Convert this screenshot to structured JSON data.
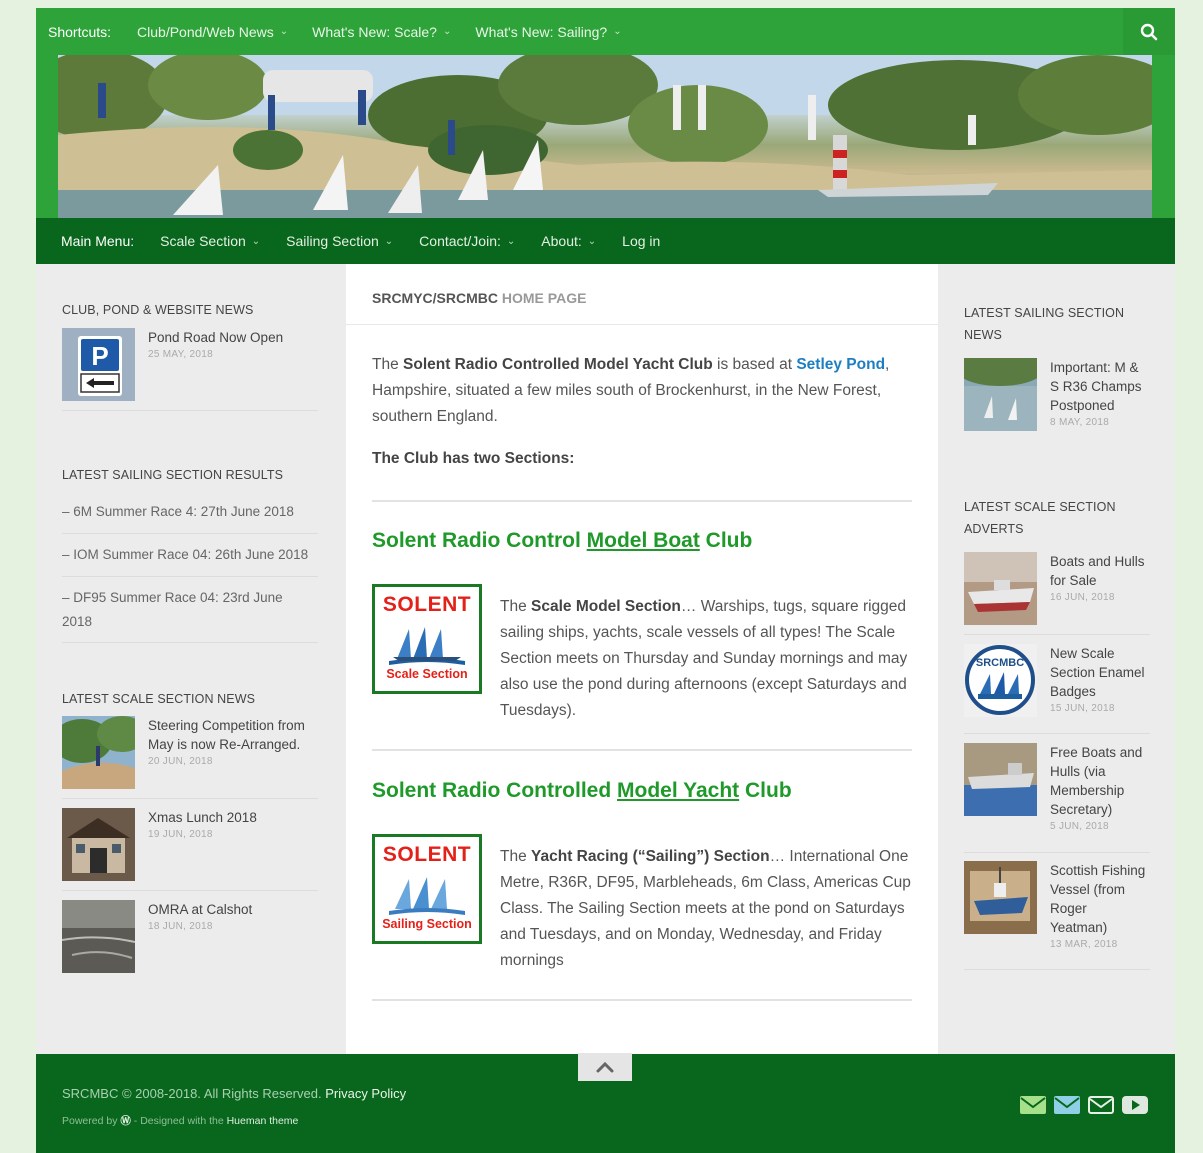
{
  "topbar": {
    "label": "Shortcuts:",
    "items": [
      {
        "label": "Club/Pond/Web News"
      },
      {
        "label": "What's New: Scale?"
      },
      {
        "label": "What's New: Sailing?"
      }
    ],
    "search_icon": "search-icon"
  },
  "main_menu": {
    "label": "Main Menu:",
    "items": [
      {
        "label": "Scale Section",
        "dropdown": true
      },
      {
        "label": "Sailing Section",
        "dropdown": true
      },
      {
        "label": "Contact/Join:",
        "dropdown": true
      },
      {
        "label": "About:",
        "dropdown": true
      },
      {
        "label": "Log in",
        "dropdown": false
      }
    ]
  },
  "left_sidebar": {
    "club_news": {
      "title": "CLUB, POND & WEBSITE NEWS",
      "posts": [
        {
          "title": "Pond Road Now Open",
          "date": "25 MAY, 2018"
        }
      ]
    },
    "sailing_results": {
      "title": "LATEST SAILING SECTION RESULTS",
      "items": [
        {
          "label": "– 6M Summer Race 4: 27th June 2018"
        },
        {
          "label": "– IOM Summer Race 04: 26th June 2018"
        },
        {
          "label_line1": "– DF95 Summer Race 04: 23rd June",
          "label_line2": "2018"
        }
      ]
    },
    "scale_news": {
      "title": "LATEST SCALE SECTION NEWS",
      "posts": [
        {
          "title_line1": "Steering Competition from",
          "title_line2": "May is now Re-Arranged.",
          "date": "20 JUN, 2018"
        },
        {
          "title": "Xmas Lunch 2018",
          "date": "19 JUN, 2018"
        },
        {
          "title": "OMRA at Calshot",
          "date": "18 JUN, 2018"
        }
      ]
    }
  },
  "content": {
    "breadcrumb": {
      "site": "SRCMYC/SRCMBC",
      "page": "HOME PAGE"
    },
    "intro": {
      "p1": "The ",
      "club_name": "Solent Radio Controlled Model Yacht Club",
      "p2": " is based at ",
      "pond_link": "Setley Pond",
      "p3": ", Hampshire, situated a few miles south of Brockenhurst, in the New Forest, southern England."
    },
    "two_sections": "The Club has two Sections:",
    "boat_club": {
      "heading_pre": "Solent Radio Control ",
      "heading_link": "Model Boat",
      "heading_post": " Club",
      "logo_word": "SOLENT",
      "logo_sub": "Scale Section",
      "text_pre": "The ",
      "text_bold": "Scale Model Section",
      "text_post": "… Warships, tugs, square rigged sailing ships, yachts, scale vessels of all types!  The Scale Section meets on Thursday and Sunday mornings and may also use the pond during afternoons (except Saturdays and Tuesdays)."
    },
    "yacht_club": {
      "heading_pre": "Solent Radio Controlled ",
      "heading_link": "Model Yacht",
      "heading_post": " Club",
      "logo_word": "SOLENT",
      "logo_sub": "Sailing Section",
      "text_pre": "The ",
      "text_bold": "Yacht Racing (“Sailing”) Section",
      "text_post": "… International One Metre, R36R, DF95, Marbleheads, 6m Class, Americas Cup Class.  The Sailing Section meets at the pond on Saturdays and Tuesdays, and on Monday, Wednesday, and Friday mornings"
    }
  },
  "right_sidebar": {
    "sailing_news": {
      "title_line1": "LATEST SAILING SECTION",
      "title_line2": "NEWS",
      "posts": [
        {
          "title_line1": "Important: M &",
          "title_line2": "S R36 Champs",
          "title_line3": "Postponed",
          "date": "8 MAY, 2018"
        }
      ]
    },
    "scale_adverts": {
      "title_line1": "LATEST SCALE SECTION",
      "title_line2": "ADVERTS",
      "posts": [
        {
          "title_line1": "Boats and Hulls",
          "title_line2": "for Sale",
          "date": "16 JUN, 2018"
        },
        {
          "title_line1": "New Scale",
          "title_line2": "Section Enamel",
          "title_line3": "Badges",
          "date": "15 JUN, 2018"
        },
        {
          "title_line1": "Free Boats and",
          "title_line2": "Hulls (via",
          "title_line3": "Membership",
          "title_line4": "Secretary)",
          "date": "5 JUN, 2018"
        },
        {
          "title_line1": "Scottish Fishing",
          "title_line2": "Vessel (from",
          "title_line3": "Roger",
          "title_line4": "Yeatman)",
          "date": "13 MAR, 2018"
        }
      ]
    }
  },
  "footer": {
    "copyright": "SRCMBC © 2008-2018. All Rights Reserved. ",
    "privacy": "Privacy Policy",
    "powered_pre": "Powered by ",
    "powered_mid": " - Designed with the ",
    "theme": "Hueman theme",
    "icons": [
      "email-icon",
      "email-icon",
      "email-outline-icon",
      "youtube-icon"
    ]
  },
  "colors": {
    "topbar": "#2ea33a",
    "main_menu": "#08671d",
    "heading_green": "#1f9a2a",
    "link_blue": "#1d7fc2",
    "logo_red": "#e32118"
  }
}
